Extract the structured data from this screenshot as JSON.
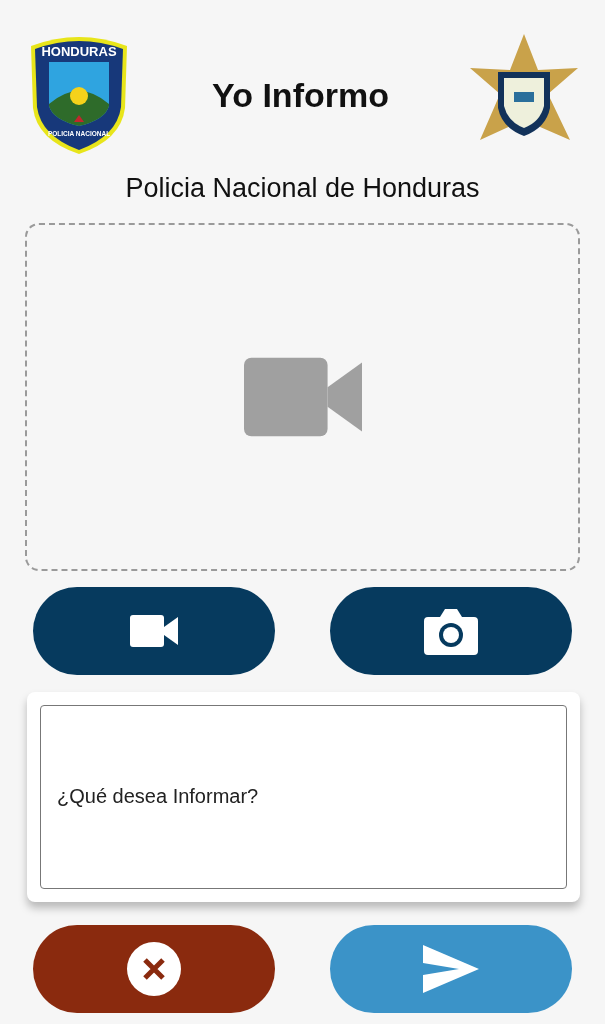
{
  "header": {
    "title": "Yo Informo",
    "subtitle": "Policia Nacional de Honduras",
    "left_emblem": {
      "top_text": "HONDURAS",
      "bottom_text": "POLICIA NACIONAL"
    }
  },
  "preview": {
    "kind": "video"
  },
  "capture_buttons": [
    {
      "kind": "video"
    },
    {
      "kind": "photo"
    }
  ],
  "report_field": {
    "placeholder": "¿Qué desea Informar?"
  },
  "action_buttons": [
    {
      "kind": "cancel",
      "color": "#8a2a0e"
    },
    {
      "kind": "send",
      "color": "#3b93c8"
    }
  ]
}
